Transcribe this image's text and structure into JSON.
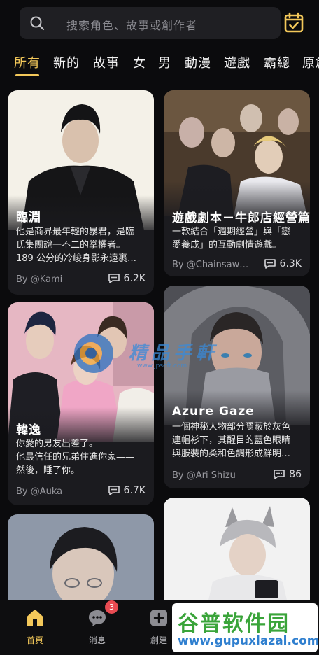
{
  "search": {
    "placeholder": "搜索角色、故事或創作者"
  },
  "tabs": [
    "所有",
    "新的",
    "故事",
    "女",
    "男",
    "動漫",
    "遊戲",
    "霸總",
    "原創"
  ],
  "accent_color": "#f3c85a",
  "cards": [
    {
      "title": "臨淵",
      "desc": [
        "他是商界最年輕的暴君，是臨",
        "氏集團說一不二的掌權者。",
        "189 公分的冷峻身影永遠裹…"
      ],
      "author": "By @Kami",
      "count": "6.2K"
    },
    {
      "title": "遊戲劇本－牛郎店經營篇",
      "desc": [
        "一款結合「週期經營」與「戀",
        "愛養成」的互動劇情遊戲。"
      ],
      "author": "By @Chainsaw…",
      "count": "6.3K"
    },
    {
      "title": "韓逸",
      "desc": [
        "你愛的男友出差了。",
        "他最信任的兄弟住進你家——",
        "然後，睡了你。"
      ],
      "author": "By @Auka",
      "count": "6.7K"
    },
    {
      "title": "Azure Gaze",
      "desc": [
        "一個神秘人物部分隱蔽於灰色",
        "連帽衫下，其醒目的藍色眼睛",
        "與服裝的柔和色調形成鮮明…"
      ],
      "author": "By @Ari Shizu",
      "count": "86"
    }
  ],
  "nav": [
    {
      "label": "首頁",
      "icon": "home-icon",
      "active": true
    },
    {
      "label": "消息",
      "icon": "message-icon",
      "badge": "3"
    },
    {
      "label": "創建",
      "icon": "create-icon"
    }
  ],
  "watermarks": {
    "center_text": "精品手軒",
    "center_sub": "www.jpsoft.com",
    "bottom_title": "谷普软件园",
    "bottom_url": "www.gupuxlazal.com"
  }
}
